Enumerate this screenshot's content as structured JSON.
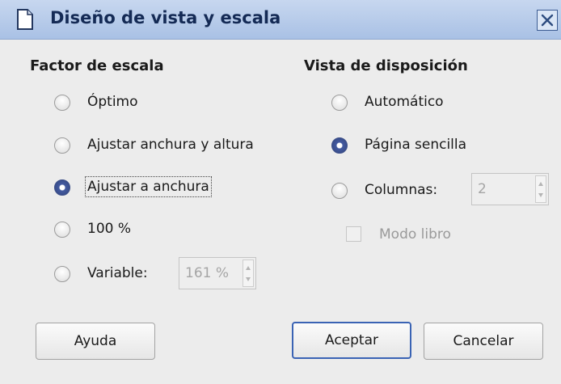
{
  "dialog": {
    "title": "Diseño de vista y escala",
    "close_icon": "close-icon",
    "doc_icon": "document-icon"
  },
  "scale": {
    "heading": "Factor de escala",
    "options": [
      {
        "label": "Óptimo",
        "checked": false
      },
      {
        "label": "Ajustar anchura y altura",
        "checked": false
      },
      {
        "label": "Ajustar a anchura",
        "checked": true
      },
      {
        "label": "100 %",
        "checked": false
      },
      {
        "label": "Variable:",
        "checked": false
      }
    ],
    "variable_value": "161 %"
  },
  "layout": {
    "heading": "Vista de disposición",
    "options": [
      {
        "label": "Automático",
        "checked": false
      },
      {
        "label": "Página sencilla",
        "checked": true
      },
      {
        "label": "Columnas:",
        "checked": false
      }
    ],
    "columns_value": "2",
    "book_mode_label": "Modo libro",
    "book_mode_checked": false
  },
  "buttons": {
    "help": "Ayuda",
    "ok": "Aceptar",
    "cancel": "Cancelar"
  },
  "colors": {
    "titlebar": "#a9c1e5",
    "accent": "#435aa0",
    "dialog_bg": "#ececec"
  }
}
